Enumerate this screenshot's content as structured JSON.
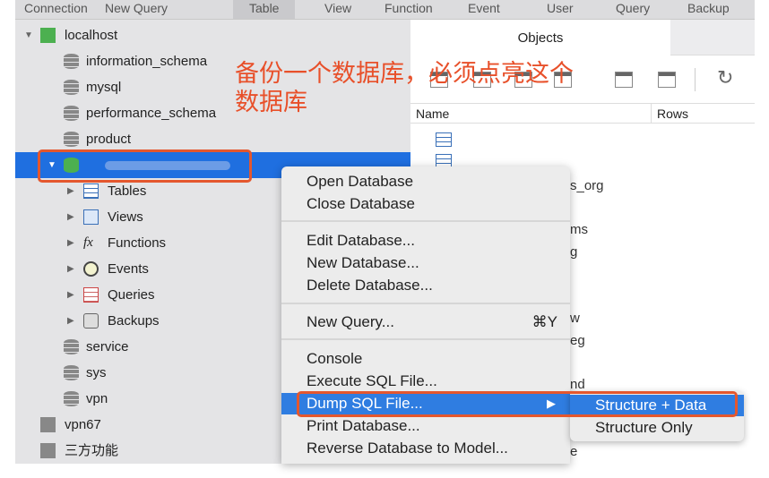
{
  "toolbar": {
    "items": [
      "Connection",
      "New Query",
      "Table",
      "View",
      "Function",
      "Event",
      "User",
      "Query",
      "Backup"
    ]
  },
  "sidebar": {
    "connection": "localhost",
    "databases": [
      "information_schema",
      "mysql",
      "performance_schema",
      "product"
    ],
    "selected_db": "",
    "subitems": [
      "Tables",
      "Views",
      "Functions",
      "Events",
      "Queries",
      "Backups"
    ],
    "more_dbs": [
      "service",
      "sys",
      "vpn"
    ],
    "other_connections": [
      "vpn67",
      "三方功能"
    ]
  },
  "annotation": {
    "line1": "备份一个数据库，必须点亮这个",
    "line2": "数据库"
  },
  "right": {
    "tab": "Objects",
    "columns": [
      "Name",
      "Rows"
    ],
    "fragments": [
      "s_org",
      "ms",
      "g",
      "w",
      "eg",
      "nd",
      "e"
    ]
  },
  "menu": {
    "items": [
      "Open Database",
      "Close Database",
      "Edit Database...",
      "New Database...",
      "Delete Database...",
      "New Query...",
      "Console",
      "Execute SQL File...",
      "Dump SQL File...",
      "Print Database...",
      "Reverse Database to Model..."
    ],
    "shortcut": "⌘Y",
    "arrow": "▶"
  },
  "submenu": {
    "items": [
      "Structure + Data",
      "Structure Only"
    ]
  },
  "colors": {
    "selection": "#1f6fe0",
    "annotation": "#e8502a"
  }
}
